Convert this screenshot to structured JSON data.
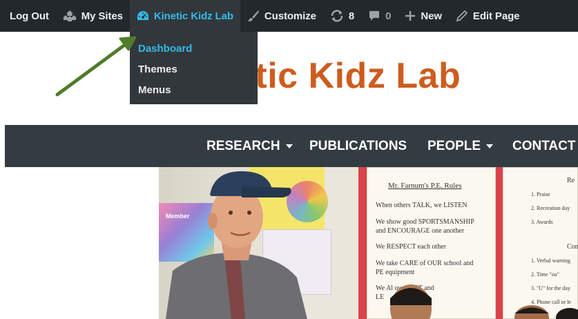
{
  "adminbar": {
    "logout": "Log Out",
    "my_sites": "My Sites",
    "site_name": "Kinetic Kidz Lab",
    "customize": "Customize",
    "updates_count": "8",
    "comments_count": "0",
    "new": "New",
    "edit_page": "Edit Page"
  },
  "dropdown": {
    "items": [
      "Dashboard",
      "Themes",
      "Menus"
    ]
  },
  "site": {
    "title": "etic Kidz Lab"
  },
  "nav": {
    "items": [
      "RESEARCH",
      "PUBLICATIONS",
      "PEOPLE",
      "CONTACT"
    ]
  },
  "poster": {
    "title": "Mr. Farnum's P.E. Rules",
    "rules": [
      "When others TALK, we LISTEN",
      "We show good SPORTSMANSHIP",
      "and ENCOURAGE one another",
      "We RESPECT each other",
      "We take CARE of OUR school and",
      "PE equipment",
      "We Al        our BEST and",
      "LE"
    ],
    "right_rules": [
      "1. Praise",
      "2. Recreation day",
      "3. Awards",
      "1. Verbal warning",
      "2. Time \"ou\"",
      "3. \"U\" for the day",
      "4. Phone call or le"
    ],
    "right_headers": [
      "Re",
      "Con"
    ],
    "badge": "Member"
  },
  "colors": {
    "adminbar_bg": "#23282d",
    "accent": "#33bbe8",
    "title": "#cd5c1e",
    "nav_bg": "#343c43",
    "arrow": "#4f7b2a"
  }
}
